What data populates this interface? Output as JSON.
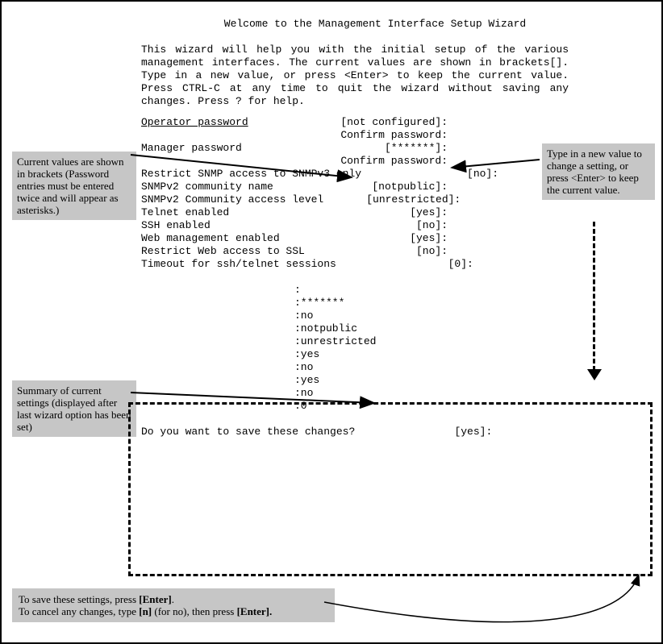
{
  "title": "Welcome to the Management Interface Setup Wizard",
  "intro": "This wizard will help you with the initial setup of the various management interfaces. The current values are shown in brackets[]. Type in a new value, or press <Enter> to keep the current value. Press CTRL-C at any time to quit the wizard without saving any changes. Press ? for help.",
  "prompts": [
    {
      "label": "Operator password",
      "value": "[not configured]:",
      "underline": true
    },
    {
      "label": "",
      "value": "Confirm password:"
    },
    {
      "label": "Manager password",
      "value": "[*******]:"
    },
    {
      "label": "",
      "value": "Confirm password:"
    },
    {
      "label": "Restrict SNMP access to SNMPv3 only",
      "value": "[no]:"
    },
    {
      "label": "SNMPv2 community name",
      "value": "[notpublic]:"
    },
    {
      "label": "SNMPv2 Community access level",
      "value": "[unrestricted]:"
    },
    {
      "label": "Telnet enabled",
      "value": "[yes]:"
    },
    {
      "label": "SSH enabled",
      "value": "[no]:"
    },
    {
      "label": "Web management enabled",
      "value": "[yes]:"
    },
    {
      "label": "Restrict Web access to SSL",
      "value": "[no]:"
    },
    {
      "label": "Timeout for ssh/telnet sessions",
      "value": "[0]:"
    }
  ],
  "summary": [
    {
      "label": "Operator password",
      "value": ":"
    },
    {
      "label": "Manager password",
      "value": ":*******"
    },
    {
      "label": "Restrict SNMP access to SNMPv3 only",
      "value": ":no"
    },
    {
      "label": "SNMPv2 community name",
      "value": ":notpublic"
    },
    {
      "label": "SNMPv2 Community access level",
      "value": ":unrestricted"
    },
    {
      "label": "Telnet enabled",
      "value": ":yes"
    },
    {
      "label": "SSH enabled",
      "value": ":no"
    },
    {
      "label": "Web management enabled",
      "value": ":yes"
    },
    {
      "label": "Restrict Web access to SSL",
      "value": ":no"
    },
    {
      "label": "Timeout for ssh/telnet sessions",
      "value": ":0"
    }
  ],
  "save_prompt": {
    "label": "Do you want to save these changes?",
    "value": "[yes]:"
  },
  "callouts": {
    "c1": "Current values are shown in brackets (Password entries must be entered twice and will appear as asterisks.)",
    "c2": "Summary of current settings (displayed after last wizard option has been set)",
    "c3": "Type in a new value to change a setting, or press <Enter> to keep the current value.",
    "c4_line1a": "To save these settings, press ",
    "c4_line1b": "[Enter]",
    "c4_line1c": ".",
    "c4_line2a": "To cancel any changes, type ",
    "c4_line2b": "[n]",
    "c4_line2c": " (for no), then press ",
    "c4_line2d": "[Enter].",
    "c4_line2e": ""
  }
}
